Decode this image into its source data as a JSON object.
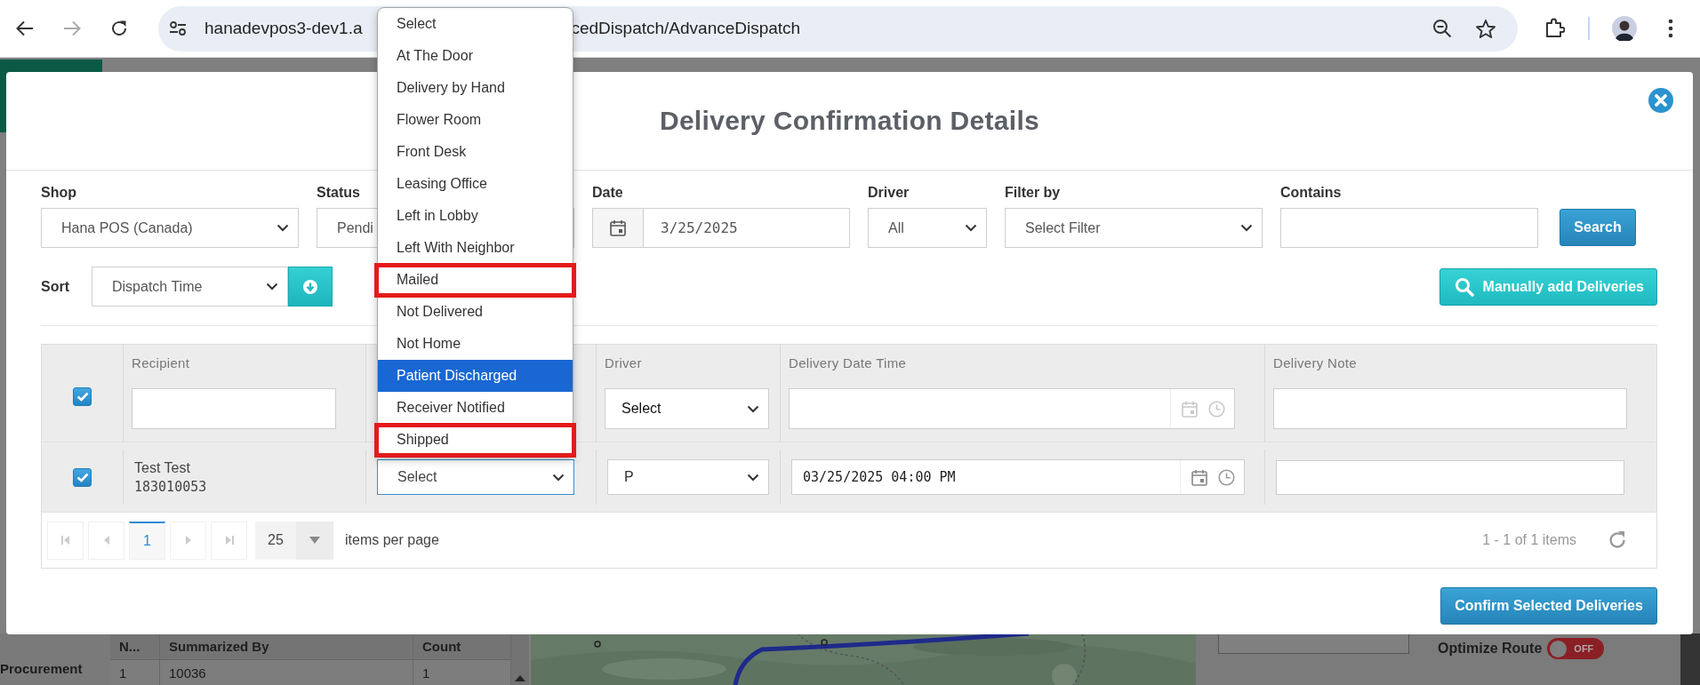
{
  "browser": {
    "url_start": "hanadevpos3-dev1.a",
    "url_end": "cedDispatch/AdvanceDispatch"
  },
  "background_app": {
    "sidebar_label": "Procurement",
    "grid": {
      "columns": [
        "N...",
        "Summarized By",
        "Count"
      ],
      "rows": [
        [
          "1",
          "10036",
          "1"
        ]
      ]
    },
    "optimize_route": {
      "label": "Optimize Route",
      "state_text": "OFF",
      "on": false
    }
  },
  "modal": {
    "title": "Delivery Confirmation Details",
    "filters": [
      {
        "label": "Shop",
        "kind": "select",
        "value": "Hana POS (Canada)"
      },
      {
        "label": "Status",
        "kind": "covered_select",
        "value": "Pendi"
      },
      {
        "label": "Date",
        "kind": "date",
        "value": "3/25/2025"
      },
      {
        "label": "Driver",
        "kind": "select",
        "value": "All"
      },
      {
        "label": "Filter by",
        "kind": "select",
        "value": "Select Filter"
      },
      {
        "label": "Contains",
        "kind": "text"
      }
    ],
    "search_button": "Search",
    "sort": {
      "label": "Sort",
      "value": "Dispatch Time"
    },
    "manual_add_button": "Manually add Deliveries",
    "table": {
      "select_all_checked": true,
      "columns": [
        {
          "label": "Recipient",
          "kind": "text"
        },
        {
          "kind": "blank"
        },
        {
          "label": "Driver",
          "kind": "select",
          "filter_value": "Select"
        },
        {
          "label": "Delivery Date Time",
          "kind": "datetime"
        },
        {
          "label": "Delivery Note",
          "kind": "text"
        }
      ],
      "rows": [
        {
          "checked": true,
          "recipient": "Test Test",
          "recipient_id": "183010053",
          "status": "Select",
          "driver": "P",
          "delivery_datetime": "03/25/2025 04:00 PM"
        }
      ]
    },
    "pager": {
      "pages": [
        {
          "label": "1",
          "selected": true
        }
      ],
      "page_size": "25",
      "items_per_page_label": "items per page",
      "summary": "1 - 1 of 1 items"
    },
    "confirm_button": "Confirm Selected Deliveries"
  },
  "status_dropdown": {
    "items": [
      {
        "label": "Select",
        "selected": false,
        "highlighted": false
      },
      {
        "label": "At The Door",
        "selected": false,
        "highlighted": false
      },
      {
        "label": "Delivery by Hand",
        "selected": false,
        "highlighted": false
      },
      {
        "label": "Flower Room",
        "selected": false,
        "highlighted": false
      },
      {
        "label": "Front Desk",
        "selected": false,
        "highlighted": false
      },
      {
        "label": "Leasing Office",
        "selected": false,
        "highlighted": false
      },
      {
        "label": "Left in Lobby",
        "selected": false,
        "highlighted": false
      },
      {
        "label": "Left With Neighbor",
        "selected": false,
        "highlighted": false
      },
      {
        "label": "Mailed",
        "selected": false,
        "highlighted": true
      },
      {
        "label": "Not Delivered",
        "selected": false,
        "highlighted": false
      },
      {
        "label": "Not Home",
        "selected": false,
        "highlighted": false
      },
      {
        "label": "Patient Discharged",
        "selected": true,
        "highlighted": false
      },
      {
        "label": "Receiver Notified",
        "selected": false,
        "highlighted": false
      },
      {
        "label": "Shipped",
        "selected": false,
        "highlighted": true
      }
    ]
  }
}
